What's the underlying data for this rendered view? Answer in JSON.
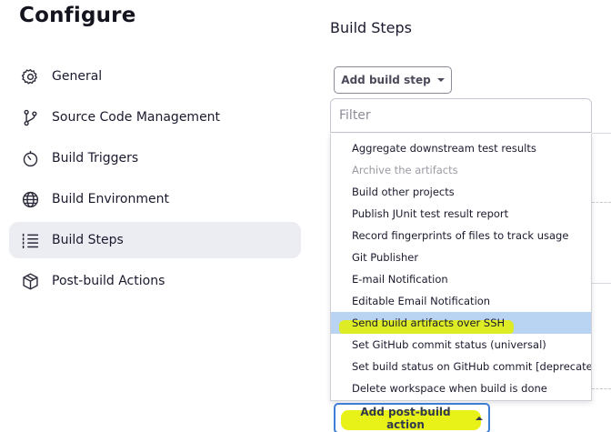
{
  "page": {
    "title": "Configure"
  },
  "sidebar": {
    "items": [
      {
        "label": "General",
        "icon": "gear-icon"
      },
      {
        "label": "Source Code Management",
        "icon": "git-branch-icon"
      },
      {
        "label": "Build Triggers",
        "icon": "timer-icon"
      },
      {
        "label": "Build Environment",
        "icon": "globe-icon"
      },
      {
        "label": "Build Steps",
        "icon": "list-icon",
        "active": true
      },
      {
        "label": "Post-build Actions",
        "icon": "package-icon"
      }
    ]
  },
  "main": {
    "section_title": "Build Steps",
    "add_build_step_label": "Add build step",
    "filter_placeholder": "Filter",
    "dropdown_items": [
      {
        "label": "Aggregate downstream test results"
      },
      {
        "label": "Archive the artifacts",
        "disabled": true
      },
      {
        "label": "Build other projects"
      },
      {
        "label": "Publish JUnit test result report"
      },
      {
        "label": "Record fingerprints of files to track usage"
      },
      {
        "label": "Git Publisher"
      },
      {
        "label": "E-mail Notification"
      },
      {
        "label": "Editable Email Notification"
      },
      {
        "label": "Send build artifacts over SSH",
        "highlighted": true
      },
      {
        "label": "Set GitHub commit status (universal)"
      },
      {
        "label": "Set build status on GitHub commit [deprecated]"
      },
      {
        "label": "Delete workspace when build is done"
      }
    ],
    "add_post_build_label": "Add post-build action"
  },
  "colors": {
    "active_bg": "#ecedf3",
    "hover_item": "#b9d3f2",
    "annotation_highlight": "#e3f000",
    "focus_border": "#3f7dd6"
  }
}
